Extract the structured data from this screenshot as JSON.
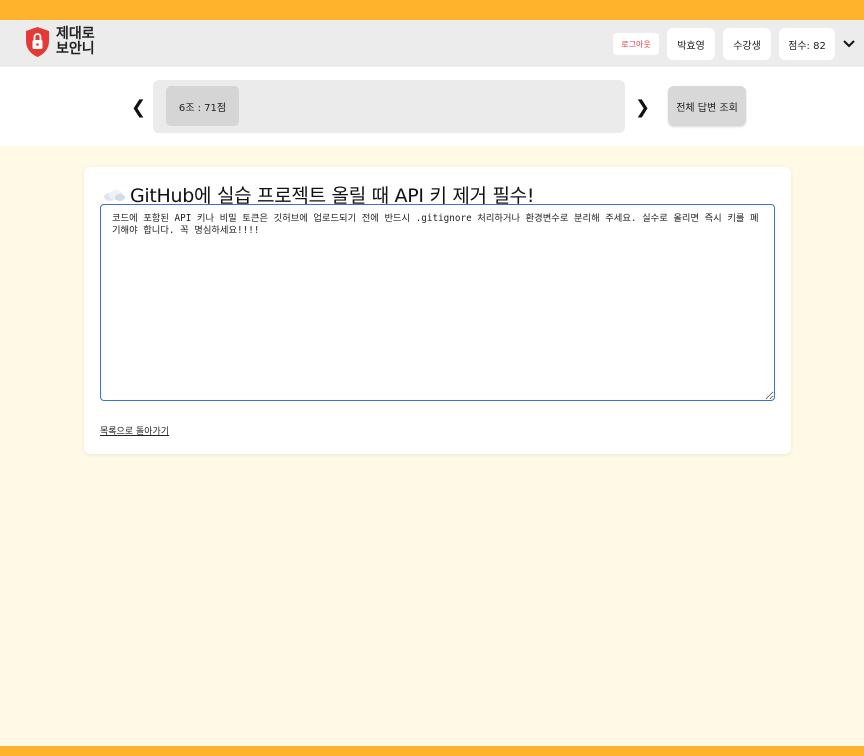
{
  "header": {
    "logo_text": "제대로 보안니",
    "logout_label": "로그아웃",
    "user_name": "박효영",
    "role_label": "수강생",
    "score_label": "점수: 82",
    "menu_icon": "chevron-down-icon"
  },
  "nav": {
    "team_chip": "6조 : 71점",
    "all_answers_label": "전체 답변 조회",
    "prev_arrow": "❮",
    "next_arrow": "❯"
  },
  "post": {
    "title_icon": "cloud-icon",
    "title": "GitHub에 실습 프로젝트 올릴 때 API 키 제거 필수!",
    "body": "코드에 포함된 API 키나 비밀 토큰은 깃허브에 업로드되기 전에 반드시 .gitignore 처리하거나 환경변수로 분리해 주세요. 실수로 올리면 즉시 키를 폐기해야 합니다. 꼭 명심하세요!!!!",
    "back_link": "목록으로 돌아가기"
  },
  "colors": {
    "accent": "#ffb22c",
    "background": "#fff9e6",
    "logout_text": "#e53935",
    "editor_border": "#3d6ee0",
    "logo_shield": "#e53935"
  }
}
